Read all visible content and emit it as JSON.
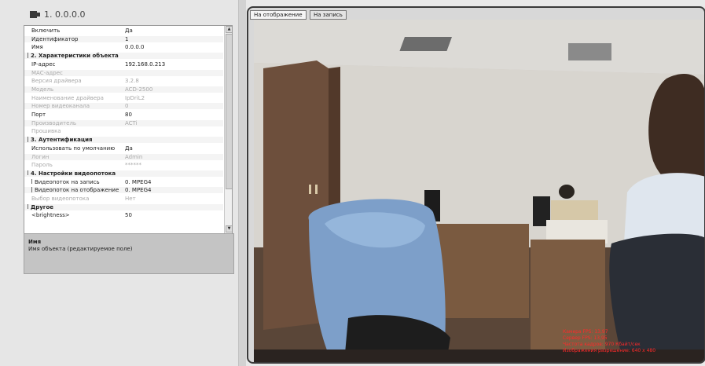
{
  "device": {
    "title": "1. 0.0.0.0",
    "icon": "camera-icon"
  },
  "properties": [
    {
      "key": "Включить",
      "value": "Да",
      "style": "normal"
    },
    {
      "key": "Идентификатор",
      "value": "1",
      "style": "normal"
    },
    {
      "key": "Имя",
      "value": "0.0.0.0",
      "style": "normal"
    },
    {
      "key": "2. Характеристики объекта",
      "value": "",
      "style": "group"
    },
    {
      "key": "IP-адрес",
      "value": "192.168.0.213",
      "style": "normal"
    },
    {
      "key": "MAC-адрес",
      "value": "",
      "style": "grey"
    },
    {
      "key": "Версия драйвера",
      "value": "3.2.8",
      "style": "grey"
    },
    {
      "key": "Модель",
      "value": "ACD-2500",
      "style": "grey"
    },
    {
      "key": "Наименование драйвера",
      "value": "IpDriL2",
      "style": "grey"
    },
    {
      "key": "Номер видеоканала",
      "value": "0",
      "style": "grey"
    },
    {
      "key": "Порт",
      "value": "80",
      "style": "normal"
    },
    {
      "key": "Производитель",
      "value": "ACTi",
      "style": "grey"
    },
    {
      "key": "Прошивка",
      "value": "",
      "style": "grey"
    },
    {
      "key": "3. Аутентификация",
      "value": "",
      "style": "group"
    },
    {
      "key": "Использовать по умолчанию",
      "value": "Да",
      "style": "normal"
    },
    {
      "key": "Логин",
      "value": "Admin",
      "style": "grey"
    },
    {
      "key": "Пароль",
      "value": "******",
      "style": "grey"
    },
    {
      "key": "4. Настройки видеопотока",
      "value": "",
      "style": "group"
    },
    {
      "key": "Видеопоток на запись",
      "value": "0. MPEG4",
      "style": "box"
    },
    {
      "key": "Видеопоток на отображение",
      "value": "0. MPEG4",
      "style": "box"
    },
    {
      "key": "Выбор видеопотока",
      "value": "Нет",
      "style": "grey"
    },
    {
      "key": "Другое",
      "value": "",
      "style": "group"
    },
    {
      "key": "<brightness>",
      "value": "50",
      "style": "normal"
    }
  ],
  "description": {
    "title": "Имя",
    "text": "Имя объекта (редактируемое поле)"
  },
  "tabs": [
    {
      "label": "На отображение",
      "active": true
    },
    {
      "label": "На запись",
      "active": false
    }
  ],
  "overlay": [
    "Камера FPS: 13,97",
    "Сервер FPS: 13,95",
    "Частота кадров: 970 Кбайт/сек",
    "Изображения разрешение: 640 x 480"
  ],
  "colors": {
    "group_bg": "#d9d4c4",
    "overlay_text": "#ff2a2a",
    "frame_border": "#3a3a3a"
  }
}
